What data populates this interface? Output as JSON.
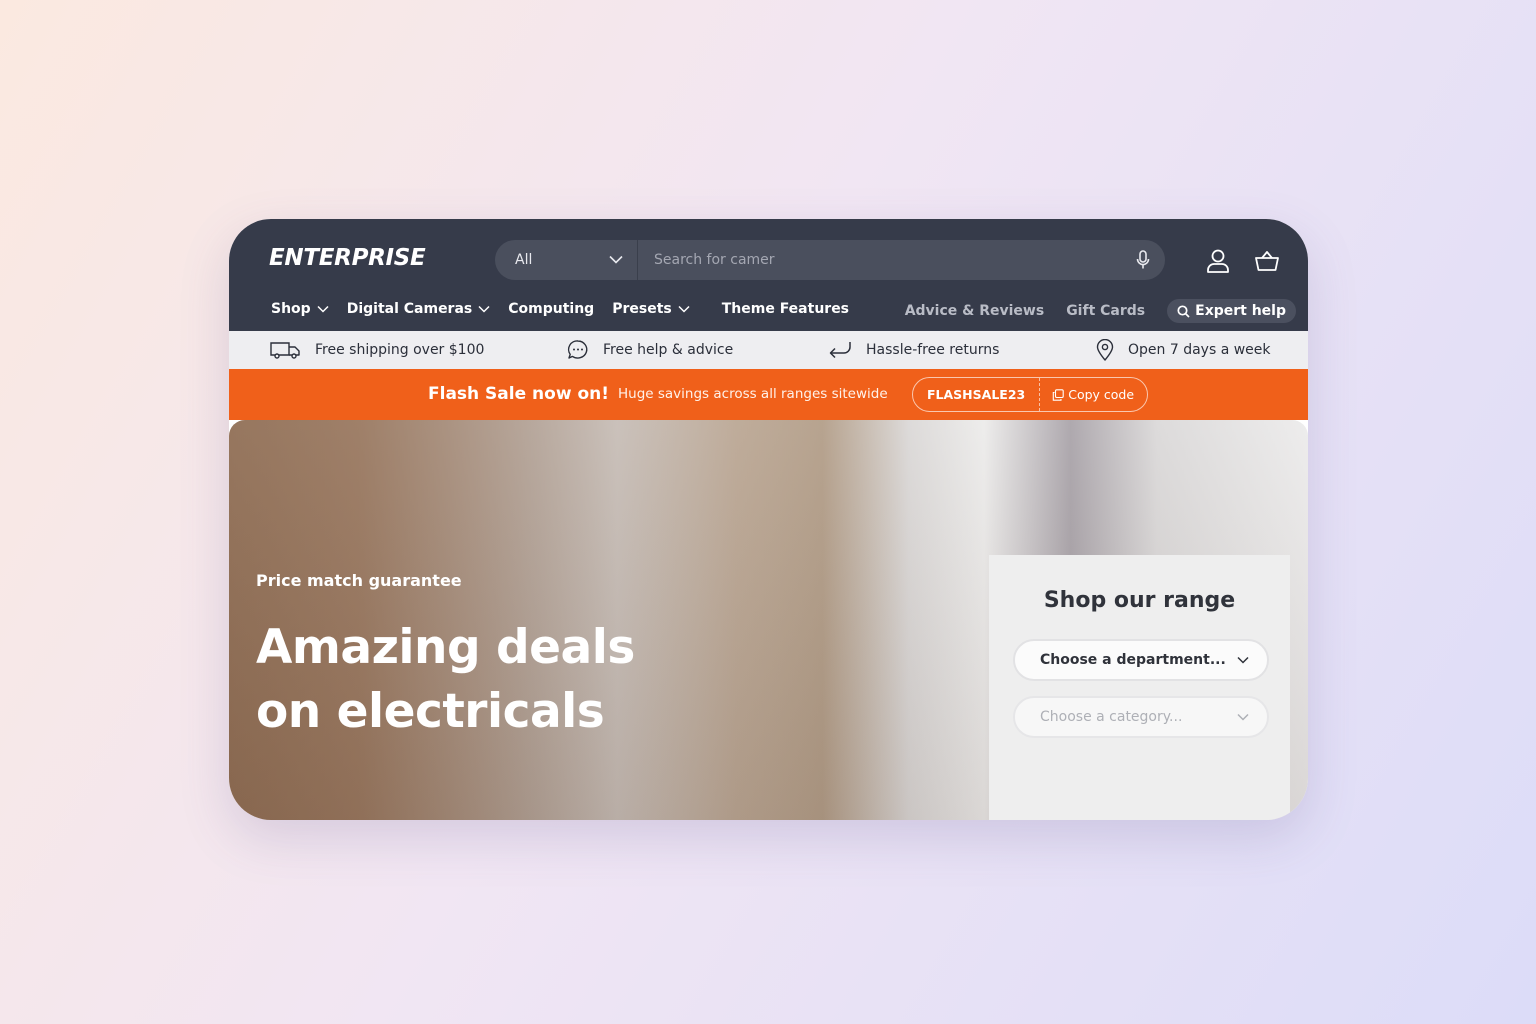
{
  "brand": {
    "logo": "ENTERPRISE"
  },
  "search": {
    "category": "All",
    "placeholder": "Search for camer"
  },
  "nav": {
    "items": [
      {
        "label": "Shop",
        "has_dropdown": true
      },
      {
        "label": "Digital Cameras",
        "has_dropdown": true
      },
      {
        "label": "Computing",
        "has_dropdown": false
      },
      {
        "label": "Presets",
        "has_dropdown": true
      },
      {
        "label": "Theme Features",
        "has_dropdown": false
      }
    ],
    "right": {
      "advice": "Advice & Reviews",
      "gift": "Gift Cards",
      "expert": "Expert help"
    }
  },
  "usp": [
    {
      "icon": "delivery-truck-icon",
      "label": "Free shipping over $100"
    },
    {
      "icon": "chat-bubble-icon",
      "label": "Free help & advice"
    },
    {
      "icon": "return-arrow-icon",
      "label": "Hassle-free returns"
    },
    {
      "icon": "location-pin-icon",
      "label": "Open 7 days a week"
    }
  ],
  "flash": {
    "title": "Flash Sale now on!",
    "subtitle": "Huge savings across all ranges sitewide",
    "code": "FLASHSALE23",
    "copy_label": "Copy code"
  },
  "hero": {
    "eyebrow": "Price match guarantee",
    "title_line1": "Amazing deals",
    "title_line2": "on electricals"
  },
  "range": {
    "title": "Shop our range",
    "department_placeholder": "Choose a department...",
    "category_placeholder": "Choose a category..."
  },
  "colors": {
    "header_bg": "#363b4a",
    "accent": "#f0601a",
    "usp_bg": "#eeeef1"
  }
}
